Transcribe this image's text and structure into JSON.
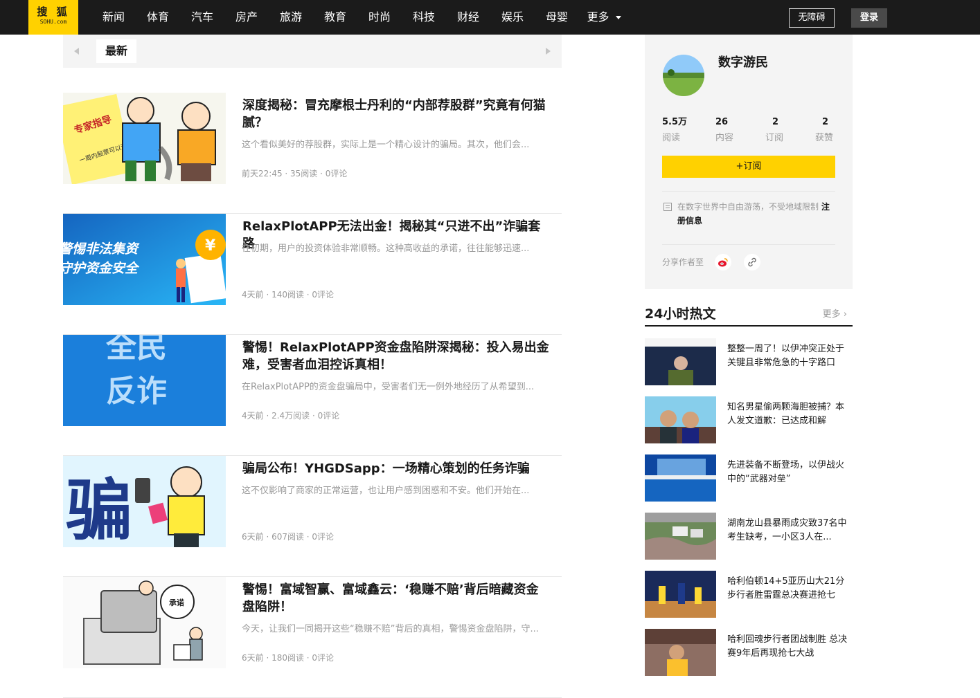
{
  "header": {
    "logo_cn": "搜 狐",
    "logo_en": "SOHU.com",
    "nav": [
      "新闻",
      "体育",
      "汽车",
      "房产",
      "旅游",
      "教育",
      "时尚",
      "科技",
      "财经",
      "娱乐",
      "母婴"
    ],
    "more": "更多",
    "accessibility": "无障碍",
    "login": "登录"
  },
  "tabs": {
    "active": "最新"
  },
  "articles": [
    {
      "title": "深度揭秘：冒充摩根士丹利的“内部荐股群”究竟有何猫腻？",
      "summary": "这个看似美好的荐股群，实际上是一个精心设计的骗局。其次，他们会...",
      "meta": "前天22:45 · 35阅读 · 0评论",
      "thumb_text_1": "专家指导",
      "thumb_text_2": "一周内股票可以涨10%"
    },
    {
      "title": "RelaxPlotAPP无法出金！揭秘其“只进不出”诈骗套路",
      "summary": "在初期，用户的投资体验非常顺畅。这种高收益的承诺，往往能够迅速...",
      "meta": "4天前 · 140阅读 · 0评论",
      "thumb_text_1": "警惕非法集资",
      "thumb_text_2": "守护资金安全",
      "thumb_symbol": "¥"
    },
    {
      "title": "警惕！RelaxPlotAPP资金盘陷阱深揭秘：投入易出金难，受害者血泪控诉真相！",
      "summary": "在RelaxPlotAPP的资金盘骗局中，受害者们无一例外地经历了从希望到...",
      "meta": "4天前 · 2.4万阅读 · 0评论",
      "thumb_text_1": "全民",
      "thumb_text_2": "反诈"
    },
    {
      "title": "骗局公布！YHGDSapp：一场精心策划的任务诈骗",
      "summary": "这不仅影响了商家的正常运营，也让用户感到困惑和不安。他们开始在...",
      "meta": "6天前 · 607阅读 · 0评论",
      "thumb_text_1": "骗"
    },
    {
      "title": "警惕！富域智赢、富域鑫云：‘稳赚不赔’背后暗藏资金盘陷阱！",
      "summary": "今天，让我们一同揭开这些“稳赚不赔”背后的真相，警惕资金盘陷阱，守...",
      "meta": "6天前 · 180阅读 · 0评论",
      "thumb_text_1": "承诺"
    }
  ],
  "author": {
    "name": "数字游民",
    "stats": [
      {
        "num": "5.5万",
        "label": "阅读"
      },
      {
        "num": "26",
        "label": "内容"
      },
      {
        "num": "2",
        "label": "订阅"
      },
      {
        "num": "2",
        "label": "获赞"
      }
    ],
    "subscribe": "+订阅",
    "bio": "在数字世界中自由游荡，不受地域限制",
    "bio_link": "注册信息",
    "share_label": "分享作者至"
  },
  "hot": {
    "title": "24小时热文",
    "more": "更多",
    "items": [
      {
        "text": "整整一周了！以伊冲突正处于关键且非常危急的十字路口"
      },
      {
        "text": "知名男星偷两颗海胆被捕？本人发文道歉：已达成和解"
      },
      {
        "text": "先进装备不断登场，以伊战火中的“武器对垒”"
      },
      {
        "text": "湖南龙山县暴雨成灾致37名中考生缺考，一小区3人在..."
      },
      {
        "text": "哈利伯顿14+5亚历山大21分步行者胜雷霆总决赛进抢七"
      },
      {
        "text": "哈利回魂步行者团战制胜 总决赛9年后再现抢七大战"
      }
    ]
  },
  "colors": {
    "accent": "#ffd100",
    "topbar": "#1b1b1b",
    "muted": "#999999"
  },
  "icons": {
    "subscribe_info": "document-icon",
    "share_weibo": "weibo-icon",
    "share_link": "link-icon",
    "dropdown": "chevron-down-icon",
    "more_arrow": "chevron-right-icon"
  }
}
